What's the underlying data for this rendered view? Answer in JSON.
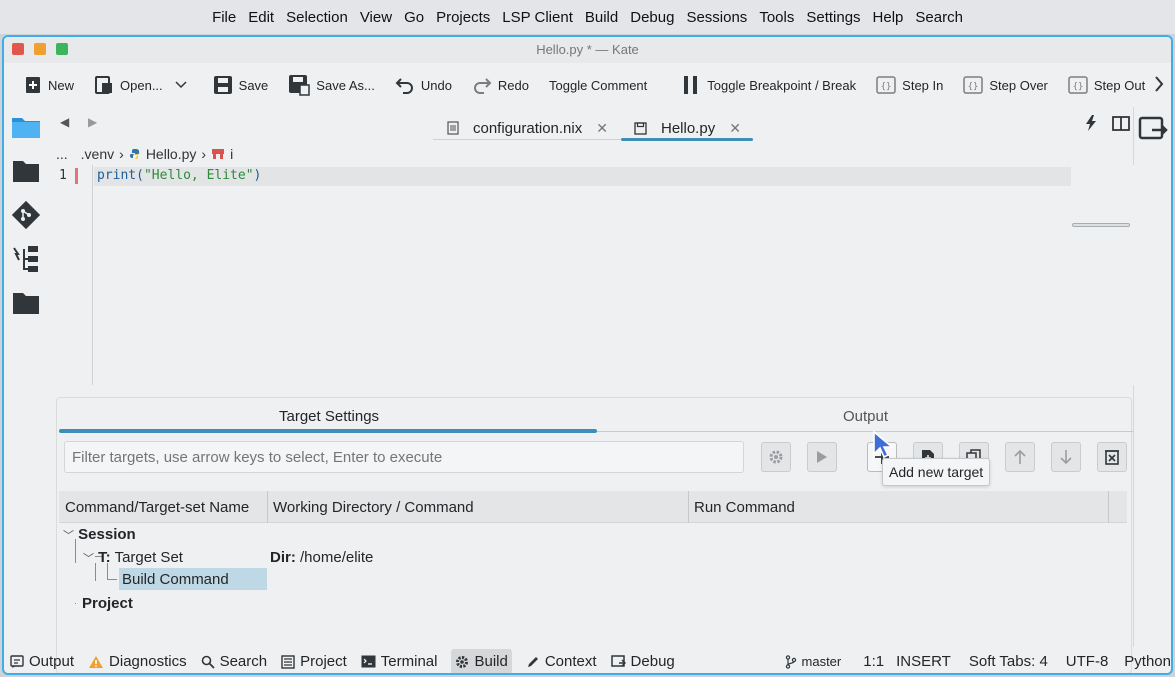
{
  "menubar": {
    "items": [
      "File",
      "Edit",
      "Selection",
      "View",
      "Go",
      "Projects",
      "LSP Client",
      "Build",
      "Debug",
      "Sessions",
      "Tools",
      "Settings",
      "Help",
      "Search"
    ]
  },
  "window": {
    "title": "Hello.py * — Kate"
  },
  "toolbar": {
    "new": "New",
    "open": "Open...",
    "save": "Save",
    "save_as": "Save As...",
    "undo": "Undo",
    "redo": "Redo",
    "toggle_comment": "Toggle Comment",
    "toggle_breakpoint": "Toggle Breakpoint / Break",
    "step_in": "Step In",
    "step_over": "Step Over",
    "step_out": "Step Out"
  },
  "tabs": [
    {
      "label": "configuration.nix",
      "active": false
    },
    {
      "label": "Hello.py",
      "active": true
    }
  ],
  "breadcrumb": {
    "ellipsis": "...",
    "folder": ".venv",
    "file": "Hello.py",
    "symbol": "i"
  },
  "editor": {
    "line_number": "1",
    "code_prefix": "print(",
    "code_string": "\"Hello, Elite\"",
    "code_suffix": ")"
  },
  "build_panel": {
    "tab_target_settings": "Target Settings",
    "tab_output": "Output",
    "filter_placeholder": "Filter targets, use arrow keys to select, Enter to execute",
    "columns": [
      "Command/Target-set Name",
      "Working Directory / Command",
      "Run Command"
    ],
    "tree": {
      "session": "Session",
      "target_set_prefix": "T:",
      "target_set": "Target Set",
      "dir_label": "Dir:",
      "dir_value": "/home/elite",
      "build_command": "Build Command",
      "project": "Project"
    },
    "tooltip": "Add new target"
  },
  "statusbar": {
    "left": [
      {
        "label": "Output",
        "icon": "output-icon"
      },
      {
        "label": "Diagnostics",
        "icon": "warning-icon"
      },
      {
        "label": "Search",
        "icon": "search-icon"
      },
      {
        "label": "Project",
        "icon": "project-icon"
      },
      {
        "label": "Terminal",
        "icon": "terminal-icon"
      },
      {
        "label": "Build",
        "icon": "gear-icon"
      },
      {
        "label": "Context",
        "icon": "pencil-icon"
      },
      {
        "label": "Debug",
        "icon": "debug-icon"
      }
    ],
    "branch": "master",
    "position": "1:1",
    "mode": "INSERT",
    "indent": "Soft Tabs: 4",
    "encoding": "UTF-8",
    "language": "Python"
  },
  "colors": {
    "accent": "#3daee9",
    "tab_underline": "#3d8fb5",
    "selection": "#bfd8e6",
    "string": "#2e8b3a",
    "warning": "#f0a030"
  }
}
